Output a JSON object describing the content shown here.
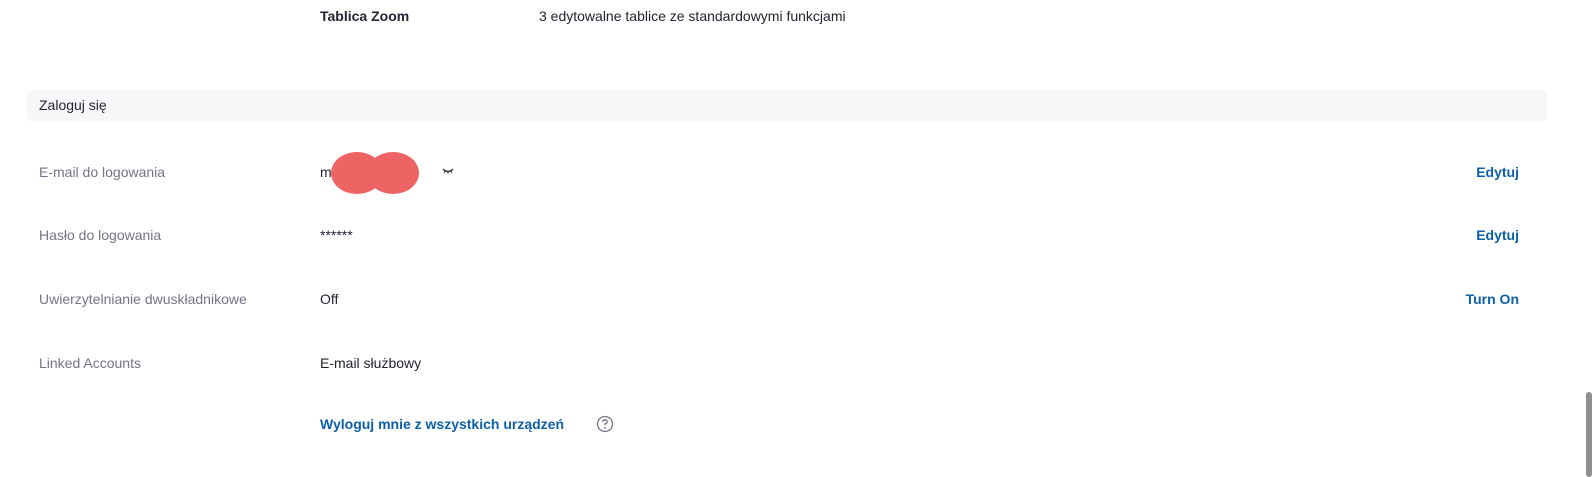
{
  "plan_row": {
    "label": "Tablica Zoom",
    "value": "3 edytowalne tablice ze standardowymi funkcjami"
  },
  "section": {
    "title": "Zaloguj się"
  },
  "rows": {
    "email": {
      "label": "E-mail do logowania",
      "value_prefix": "m",
      "action": "Edytuj"
    },
    "password": {
      "label": "Hasło do logowania",
      "value": "******",
      "action": "Edytuj"
    },
    "two_factor": {
      "label": "Uwierzytelnianie dwuskładnikowe",
      "value": "Off",
      "action": "Turn On"
    },
    "linked": {
      "label": "Linked Accounts",
      "value": "E-mail służbowy"
    }
  },
  "logout": {
    "label": "Wyloguj mnie z wszystkich urządzeń"
  },
  "colors": {
    "link": "#0e5fa9",
    "muted_label": "#747487",
    "redaction": "#ee6464",
    "section_bg": "#f7f7fa"
  },
  "icons": {
    "eye": "eye-closed-icon",
    "help": "help-circle-icon"
  }
}
